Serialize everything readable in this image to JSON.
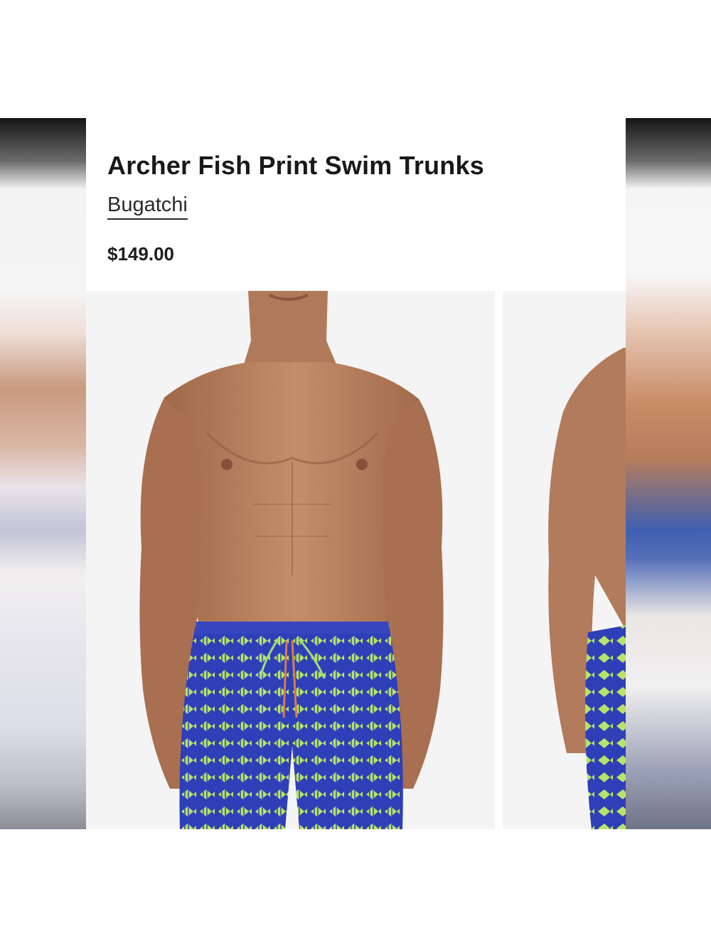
{
  "product": {
    "title": "Archer Fish Print Swim Trunks",
    "brand": "Bugatchi",
    "price": "$149.00"
  },
  "gallery": {
    "images": [
      {
        "description": "front view of model wearing blue fish print swim trunks"
      },
      {
        "description": "side view of model wearing blue fish print swim trunks"
      }
    ]
  },
  "colors": {
    "trunks_blue": "#2f3fb8",
    "print_green": "#b7e36a",
    "skin": "#b9805f",
    "text": "#191919"
  }
}
